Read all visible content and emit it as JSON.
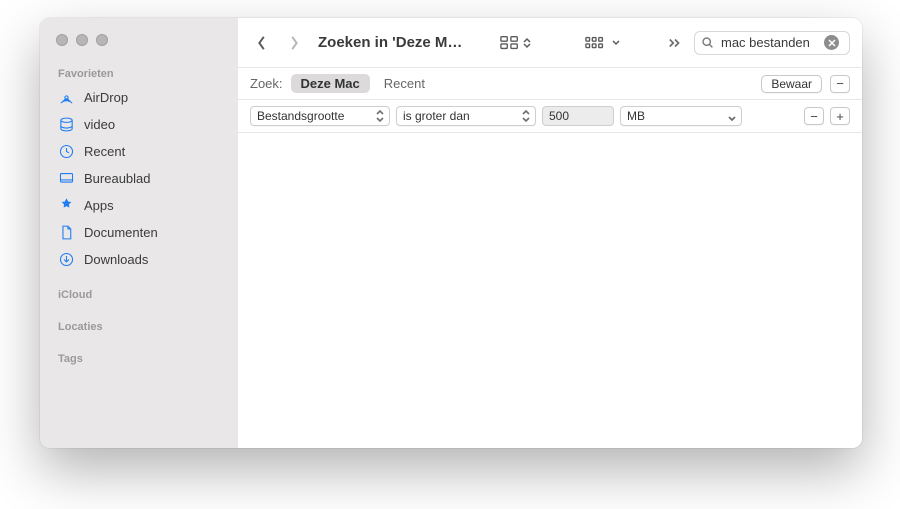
{
  "sidebar": {
    "sections": {
      "favorites": "Favorieten",
      "icloud": "iCloud",
      "locations": "Locaties",
      "tags": "Tags"
    },
    "items": [
      {
        "label": "AirDrop"
      },
      {
        "label": "video"
      },
      {
        "label": "Recent"
      },
      {
        "label": "Bureaublad"
      },
      {
        "label": "Apps"
      },
      {
        "label": "Documenten"
      },
      {
        "label": "Downloads"
      }
    ]
  },
  "toolbar": {
    "title": "Zoeken in 'Deze M…",
    "search_value": "mac bestanden"
  },
  "searchbar": {
    "label": "Zoek:",
    "scope_selected": "Deze Mac",
    "scope_other": "Recent",
    "save_label": "Bewaar"
  },
  "criteria": {
    "attribute": "Bestandsgrootte",
    "comparator": "is groter dan",
    "value": "500",
    "unit": "MB"
  }
}
